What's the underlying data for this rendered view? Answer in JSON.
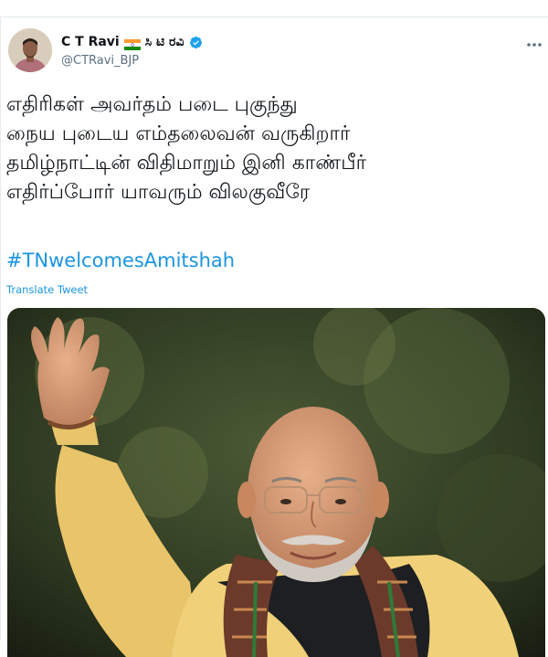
{
  "tweet": {
    "display_name": "C T Ravi",
    "name_suffix": "ಸಿ ಟಿ ರವಿ",
    "handle": "@CTRavi_BJP",
    "text_lines": [
      "எதிரிகள் அவர்தம் படை புகுந்து",
      "நைய புடைய எம்தலைவன் வருகிறார்",
      "தமிழ்நாட்டின் விதிமாறும் இனி காண்பீர்",
      "எதிர்ப்போர் யாவரும் விலகுவீரே"
    ],
    "hashtag": "#TNwelcomesAmitshah",
    "translate_label": "Translate Tweet"
  },
  "icons": {
    "flag": "india-flag-icon",
    "verified": "verified-badge-icon",
    "more": "more-options-icon"
  },
  "colors": {
    "link": "#1b95e0",
    "verified": "#1da1f2",
    "handle": "#5b7083"
  }
}
